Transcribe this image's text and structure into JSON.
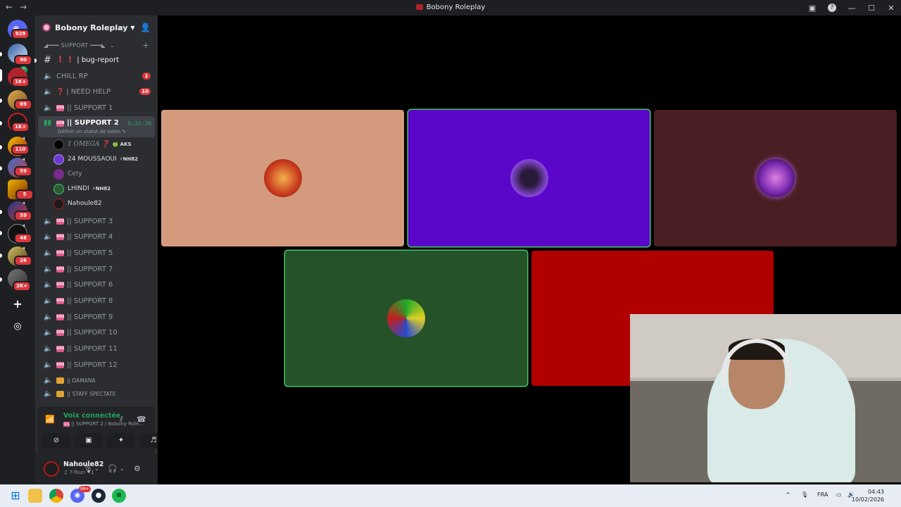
{
  "window": {
    "title": "Bobony Roleplay",
    "nav_back": "←",
    "nav_forward": "→",
    "help": "?",
    "minimize": "—",
    "maximize": "☐",
    "close": "✕"
  },
  "guild_bar": {
    "dm_badge": "929",
    "guilds": [
      {
        "badge": "90"
      },
      {
        "badge": "1K+"
      },
      {
        "badge": "69"
      },
      {
        "badge": "1K+"
      },
      {
        "badge": "110"
      },
      {
        "badge": "59"
      },
      {
        "badge": "5"
      },
      {
        "badge": "59"
      },
      {
        "badge": "48"
      },
      {
        "badge": "26"
      },
      {
        "badge": "2K+"
      }
    ],
    "add_server": "+",
    "discover": "◎"
  },
  "server": {
    "name": "Bobony Roleplay",
    "category": "◢━━━ SUPPORT ━━━◣",
    "category_caret": "⌄",
    "category_add": "+"
  },
  "channels": {
    "bug_report": "| bug-report",
    "bug_prefix": "❗ ❗",
    "chill": "CHILL RP",
    "chill_unread": "1",
    "need_help": "| NEED HELP",
    "need_help_prefix": "❓",
    "need_help_unread": "10",
    "support1": "|| SUPPORT 1",
    "support2": "|| SUPPORT 2",
    "support2_timer": "6:33:20",
    "support2_status": "Définir un statut de salon ✎",
    "support3": "|| SUPPORT 3",
    "support4": "|| SUPPORT 4",
    "support5": "|| SUPPORT 5",
    "support7": "|| SUPPORT 7",
    "support6": "|| SUPPORT 6",
    "support8": "|| SUPPORT 8",
    "support9": "|| SUPPORT 9",
    "support10": "|| SUPPORT 10",
    "support11": "|| SUPPORT 11",
    "support12": "|| SUPPORT 12",
    "damana": "|| DAMANA",
    "staff": "|| STAFF SPECTATE",
    "sos": "SOS"
  },
  "voice_users": [
    {
      "name": "1 OMEGA ❓",
      "tag": "🍏 AKS"
    },
    {
      "name": "24 MOUSSAOUI",
      "tag": "⚡NH82"
    },
    {
      "name": "Cety",
      "tag": ""
    },
    {
      "name": "LHINDI",
      "tag": "⚡NH82"
    },
    {
      "name": "Nahoule82",
      "tag": ""
    }
  ],
  "voice_panel": {
    "status": "Voix connectée",
    "location": "|| SUPPORT 2 / Bobony Role..."
  },
  "user_panel": {
    "username": "Nahoule82",
    "status": "♫ 7-Toun +1"
  },
  "taskbar": {
    "lang": "FRA",
    "time": "04:43",
    "date": "10/02/2026",
    "chrome_badge": "99+"
  },
  "colors": {
    "tile1": "#d49a7d",
    "tile2": "#5a07c9",
    "tile3": "#4a1e22",
    "tile4": "#255229",
    "tile5": "#b00000",
    "speaking": "#43c86a",
    "connected": "#23a55a"
  }
}
